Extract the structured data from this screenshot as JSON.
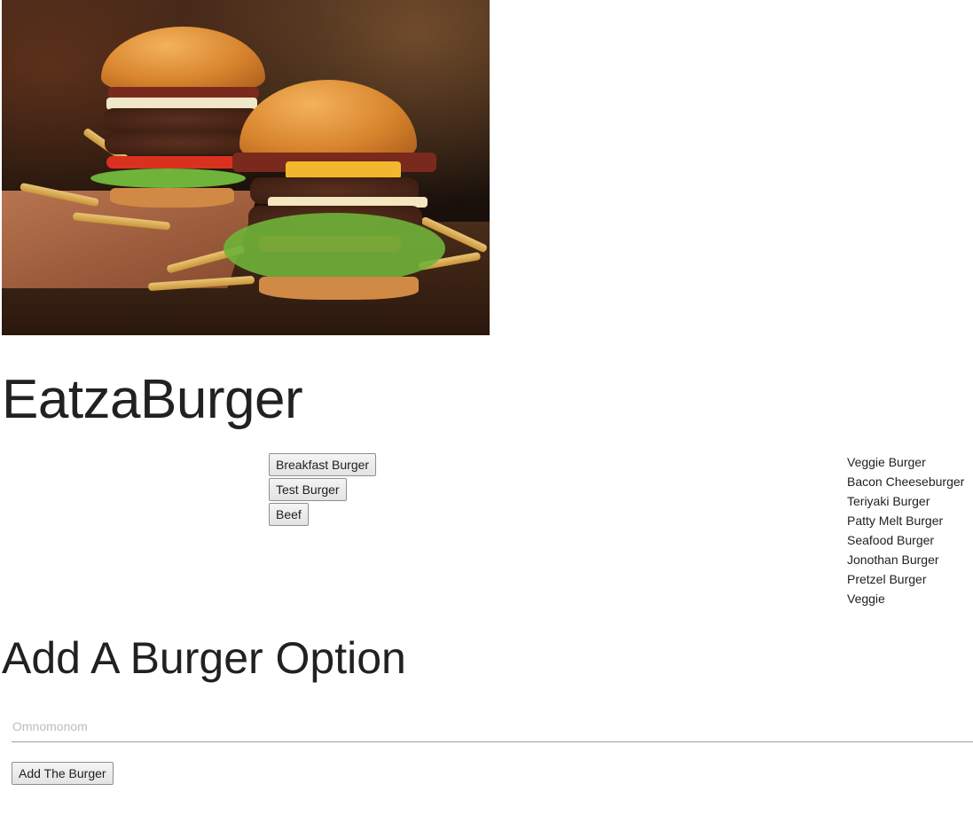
{
  "hero": {
    "icon": "burger-photo"
  },
  "page": {
    "title": "EatzaBurger"
  },
  "to_devour": [
    {
      "label": "Breakfast Burger"
    },
    {
      "label": "Test Burger"
    },
    {
      "label": "Beef"
    }
  ],
  "devoured": [
    "Veggie Burger",
    "Bacon Cheeseburger",
    "Teriyaki Burger",
    "Patty Melt Burger",
    "Seafood Burger",
    "Jonothan Burger",
    "Pretzel Burger",
    "Veggie"
  ],
  "form": {
    "heading": "Add A Burger Option",
    "placeholder": "Omnomonom",
    "value": "",
    "submit_label": "Add The Burger"
  },
  "colors": {
    "text": "#212121",
    "input_underline": "#9e9e9e",
    "placeholder": "#bdbdbd"
  }
}
